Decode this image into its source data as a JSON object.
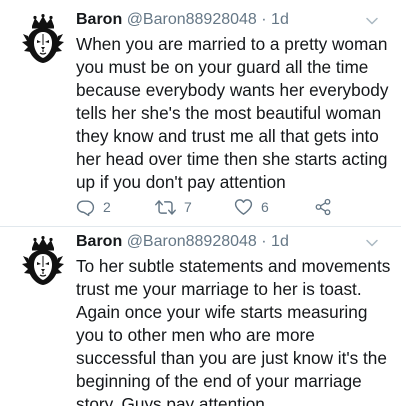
{
  "tweets": [
    {
      "name": "Baron",
      "handle": "@Baron88928048",
      "separator": "·",
      "time": "1d",
      "text": "When you are married to a pretty woman\nyou must be on your guard all the time\nbecause everybody wants her everybody\ntells her she's the most beautiful woman\nthey know and  trust me all that gets into\nher head over time then she starts acting\nup if you don't pay attention",
      "replies": "2",
      "retweets": "7",
      "likes": "6"
    },
    {
      "name": "Baron",
      "handle": "@Baron88928048",
      "separator": "·",
      "time": "1d",
      "text": "To her subtle statements and movements\ntrust me your marriage to her is toast.\nAgain once your wife starts measuring\nyou to other men who are more\nsuccessful than you are just know it's the\nbeginning of the end of your marriage\nstory. Guys pay attention."
    }
  ],
  "colors": {
    "text": "#14171a",
    "secondary": "#657786",
    "divider": "#e1e8ed"
  },
  "icons": {
    "avatar": "crowned-lion-logo",
    "menu": "chevron-down-icon",
    "reply": "reply-icon",
    "retweet": "retweet-icon",
    "like": "heart-icon",
    "share": "share-icon"
  }
}
